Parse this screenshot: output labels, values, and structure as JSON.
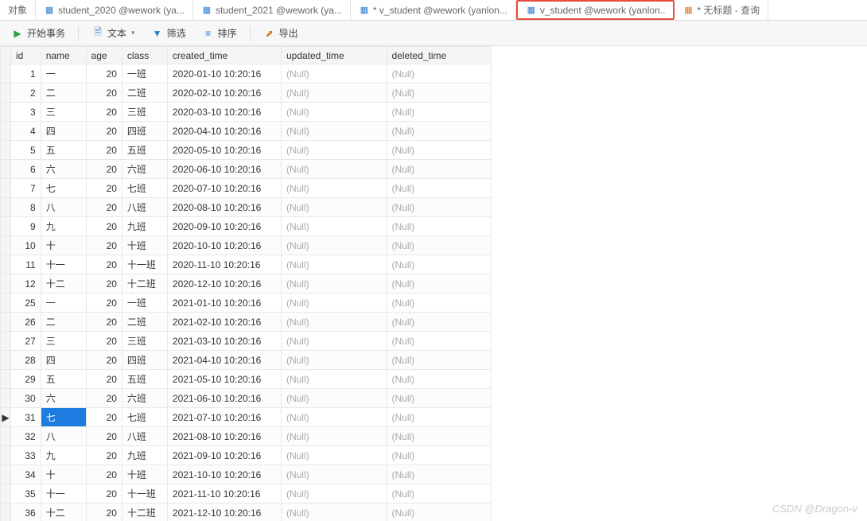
{
  "tabs": [
    {
      "label": "对象",
      "icon": ""
    },
    {
      "label": "student_2020 @wework (ya...",
      "icon": "table"
    },
    {
      "label": "student_2021 @wework (ya...",
      "icon": "table"
    },
    {
      "label": "* v_student @wework (yanlon...",
      "icon": "view",
      "modified": true
    },
    {
      "label": "v_student @wework (yanlon..",
      "icon": "view",
      "highlighted": true
    },
    {
      "label": "* 无标题 - 查询",
      "icon": "query",
      "modified": true
    }
  ],
  "toolbar": {
    "begin_tx": "开始事务",
    "text": "文本",
    "filter": "筛选",
    "sort": "排序",
    "export": "导出"
  },
  "columns": [
    "id",
    "name",
    "age",
    "class",
    "created_time",
    "updated_time",
    "deleted_time"
  ],
  "null_label": "(Null)",
  "selected_row": 18,
  "rows": [
    {
      "id": 1,
      "name": "一",
      "age": 20,
      "class": "一班",
      "created_time": "2020-01-10 10:20:16",
      "updated_time": null,
      "deleted_time": null
    },
    {
      "id": 2,
      "name": "二",
      "age": 20,
      "class": "二班",
      "created_time": "2020-02-10 10:20:16",
      "updated_time": null,
      "deleted_time": null
    },
    {
      "id": 3,
      "name": "三",
      "age": 20,
      "class": "三班",
      "created_time": "2020-03-10 10:20:16",
      "updated_time": null,
      "deleted_time": null
    },
    {
      "id": 4,
      "name": "四",
      "age": 20,
      "class": "四班",
      "created_time": "2020-04-10 10:20:16",
      "updated_time": null,
      "deleted_time": null
    },
    {
      "id": 5,
      "name": "五",
      "age": 20,
      "class": "五班",
      "created_time": "2020-05-10 10:20:16",
      "updated_time": null,
      "deleted_time": null
    },
    {
      "id": 6,
      "name": "六",
      "age": 20,
      "class": "六班",
      "created_time": "2020-06-10 10:20:16",
      "updated_time": null,
      "deleted_time": null
    },
    {
      "id": 7,
      "name": "七",
      "age": 20,
      "class": "七班",
      "created_time": "2020-07-10 10:20:16",
      "updated_time": null,
      "deleted_time": null
    },
    {
      "id": 8,
      "name": "八",
      "age": 20,
      "class": "八班",
      "created_time": "2020-08-10 10:20:16",
      "updated_time": null,
      "deleted_time": null
    },
    {
      "id": 9,
      "name": "九",
      "age": 20,
      "class": "九班",
      "created_time": "2020-09-10 10:20:16",
      "updated_time": null,
      "deleted_time": null
    },
    {
      "id": 10,
      "name": "十",
      "age": 20,
      "class": "十班",
      "created_time": "2020-10-10 10:20:16",
      "updated_time": null,
      "deleted_time": null
    },
    {
      "id": 11,
      "name": "十一",
      "age": 20,
      "class": "十一班",
      "created_time": "2020-11-10 10:20:16",
      "updated_time": null,
      "deleted_time": null
    },
    {
      "id": 12,
      "name": "十二",
      "age": 20,
      "class": "十二班",
      "created_time": "2020-12-10 10:20:16",
      "updated_time": null,
      "deleted_time": null
    },
    {
      "id": 25,
      "name": "一",
      "age": 20,
      "class": "一班",
      "created_time": "2021-01-10 10:20:16",
      "updated_time": null,
      "deleted_time": null
    },
    {
      "id": 26,
      "name": "二",
      "age": 20,
      "class": "二班",
      "created_time": "2021-02-10 10:20:16",
      "updated_time": null,
      "deleted_time": null
    },
    {
      "id": 27,
      "name": "三",
      "age": 20,
      "class": "三班",
      "created_time": "2021-03-10 10:20:16",
      "updated_time": null,
      "deleted_time": null
    },
    {
      "id": 28,
      "name": "四",
      "age": 20,
      "class": "四班",
      "created_time": "2021-04-10 10:20:16",
      "updated_time": null,
      "deleted_time": null
    },
    {
      "id": 29,
      "name": "五",
      "age": 20,
      "class": "五班",
      "created_time": "2021-05-10 10:20:16",
      "updated_time": null,
      "deleted_time": null
    },
    {
      "id": 30,
      "name": "六",
      "age": 20,
      "class": "六班",
      "created_time": "2021-06-10 10:20:16",
      "updated_time": null,
      "deleted_time": null
    },
    {
      "id": 31,
      "name": "七",
      "age": 20,
      "class": "七班",
      "created_time": "2021-07-10 10:20:16",
      "updated_time": null,
      "deleted_time": null
    },
    {
      "id": 32,
      "name": "八",
      "age": 20,
      "class": "八班",
      "created_time": "2021-08-10 10:20:16",
      "updated_time": null,
      "deleted_time": null
    },
    {
      "id": 33,
      "name": "九",
      "age": 20,
      "class": "九班",
      "created_time": "2021-09-10 10:20:16",
      "updated_time": null,
      "deleted_time": null
    },
    {
      "id": 34,
      "name": "十",
      "age": 20,
      "class": "十班",
      "created_time": "2021-10-10 10:20:16",
      "updated_time": null,
      "deleted_time": null
    },
    {
      "id": 35,
      "name": "十一",
      "age": 20,
      "class": "十一班",
      "created_time": "2021-11-10 10:20:16",
      "updated_time": null,
      "deleted_time": null
    },
    {
      "id": 36,
      "name": "十二",
      "age": 20,
      "class": "十二班",
      "created_time": "2021-12-10 10:20:16",
      "updated_time": null,
      "deleted_time": null
    }
  ],
  "watermark": "CSDN @Dragon-v"
}
